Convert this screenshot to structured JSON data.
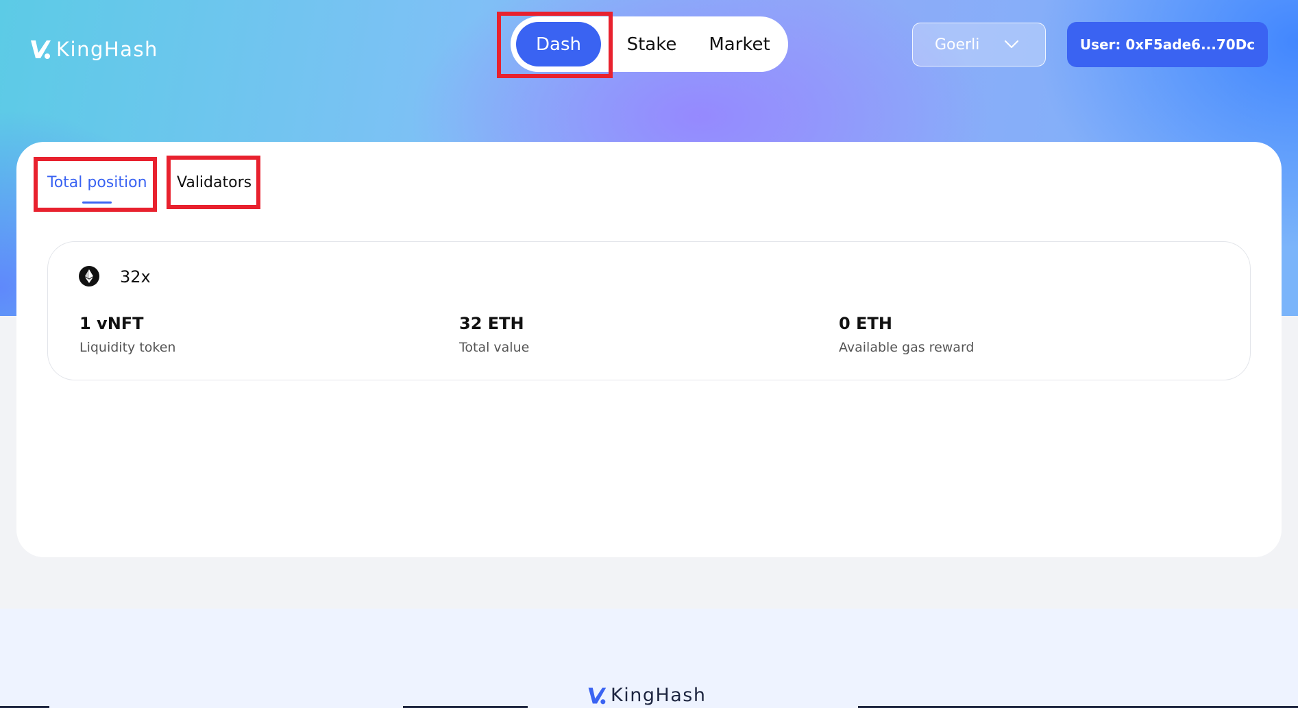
{
  "brand": {
    "name": "KingHash"
  },
  "nav": {
    "items": [
      "Dash",
      "Stake",
      "Market"
    ],
    "active": "Dash"
  },
  "network": {
    "selected": "Goerli"
  },
  "user": {
    "label": "User: 0xF5ade6...70Dc"
  },
  "tabs": {
    "total_position": "Total position",
    "validators": "Validators",
    "active": "Total position"
  },
  "position": {
    "multiplier": "32x",
    "stats": [
      {
        "value": "1 vNFT",
        "label": "Liquidity token"
      },
      {
        "value": "32 ETH",
        "label": "Total value"
      },
      {
        "value": "0 ETH",
        "label": "Available gas reward"
      }
    ]
  },
  "colors": {
    "accent": "#3a63f2",
    "highlight_box": "#e8212e",
    "muted_text": "#555555"
  },
  "icons": {
    "logo": "kinghash-logo-icon",
    "eth": "ethereum-icon",
    "dropdown": "chevron-down-icon"
  }
}
